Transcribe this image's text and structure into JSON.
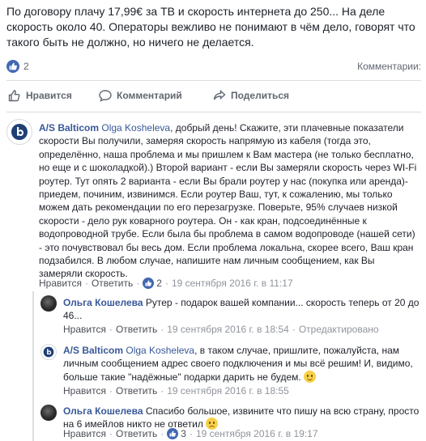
{
  "post": {
    "text": "По договору плачу 17,99€ за ТВ и скорость интернета до 250... На деле скорость около 40. Операторы вежливо не понимают в чём дело, говорят что такого быть не должно, но ничего не делается."
  },
  "summary": {
    "like_count": "2",
    "comments_label": "Комментарии:"
  },
  "actions": {
    "like": "Нравится",
    "comment": "Комментарий",
    "share": "Поделиться"
  },
  "comments": [
    {
      "author": "A/S Balticom",
      "mention": "Olga Kosheleva",
      "text": ", добрый день! Скажите, эти плачевные показатели скорости Вы получили, замеряя скорость напрямую из кабеля (тогда это, определённо, наша проблема и мы пришлем к Вам мастера (не только бесплатно, но еще и с шоколадкой).) Второй вариант - если Вы замеряли скорость через WI-Fi роутер. Тут опять 2 варианта - если Вы брали роутер у нас (покупка или аренда)- приедем, починим, извинимся. Если роутер Ваш, тут, к сожалению, мы только можем дать рекомендации по его перезагрузке. Поверьте, 95% случаев низкой скорости - дело рук коварного роутера. Он - как кран, подсоединённые к водопроводной трубе. Если была бы проблема в самом водопроводе (нашей сети) - это почувствовал бы весь дом. Если проблема локальна, скорее всего, Ваш кран подзабился. В любом случае, напишите нам личным сообщением, как Вы замеряли скорость.",
      "meta": {
        "like": "Нравится",
        "reply": "Ответить",
        "reactions": "2",
        "date": "19 сентября 2016 г. в 11:17"
      }
    },
    {
      "author": "Ольга Кошелева",
      "text": "Рутер - подарок вашей компании... скорость теперь от 20 до 46...",
      "meta": {
        "like": "Нравится",
        "reply": "Ответить",
        "date": "19 сентября 2016 г. в 18:54",
        "edited": "Отредактировано"
      }
    },
    {
      "author": "A/S Balticom",
      "mention": "Olga Kosheleva",
      "text": ", в таком случае, пришлите, пожалуйста, нам личным сообщением адрес своего подключения и мы всё решим! И, видимо, больше такие \"надёжные\" подарки дарить не будем.",
      "meta": {
        "like": "Нравится",
        "reply": "Ответить",
        "date": "19 сентября 2016 г. в 18:55"
      }
    },
    {
      "author": "Ольга Кошелева",
      "text": "Спасибо большое, извините что пишу на всю страну, просто на 6 имейлов никто не ответил",
      "meta": {
        "like": "Нравится",
        "reply": "Ответить",
        "reactions": "3",
        "date": "19 сентября 2016 г. в 19:17"
      }
    }
  ],
  "colors": {
    "link": "#385898",
    "like_blue": "#4267b2",
    "muted": "#90949c"
  },
  "icons": [
    "like-icon",
    "thumbs-up-icon",
    "comment-icon",
    "share-icon",
    "balticom-logo",
    "smile-emoji",
    "sad-emoji"
  ]
}
